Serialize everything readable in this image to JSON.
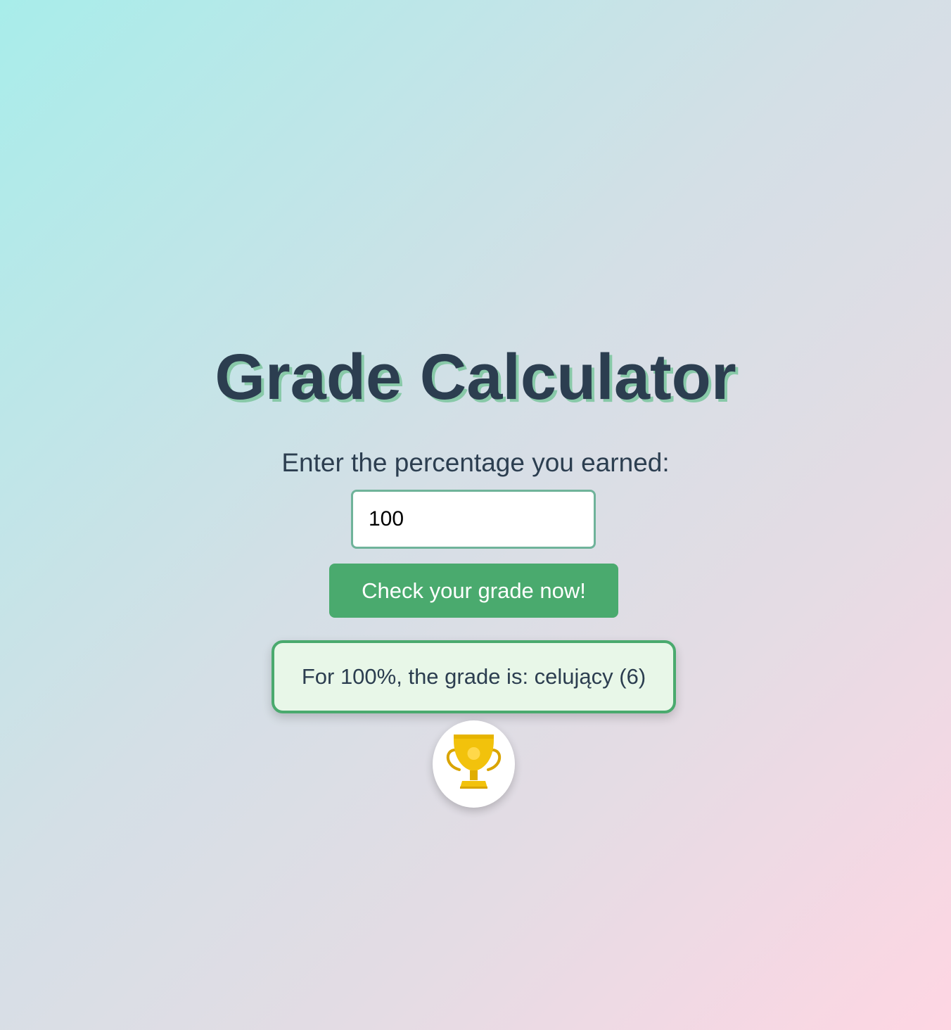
{
  "app": {
    "title": "Grade Calculator",
    "prompt": "Enter the percentage you earned:"
  },
  "form": {
    "percentage_value": "100",
    "check_button_label": "Check your grade now!"
  },
  "result": {
    "message": "For 100%, the grade is: celujący (6)",
    "icon": "trophy-icon"
  },
  "colors": {
    "title_text": "#2c3e50",
    "title_shadow": "#88c9a8",
    "button_bg": "#4aaa6e",
    "input_border": "#6fb39a",
    "result_border": "#4aaa6e",
    "result_bg": "#e8f7e8",
    "trophy_gold": "#f2c20c",
    "background_start": "#a8edea",
    "background_end": "#fed6e3"
  }
}
